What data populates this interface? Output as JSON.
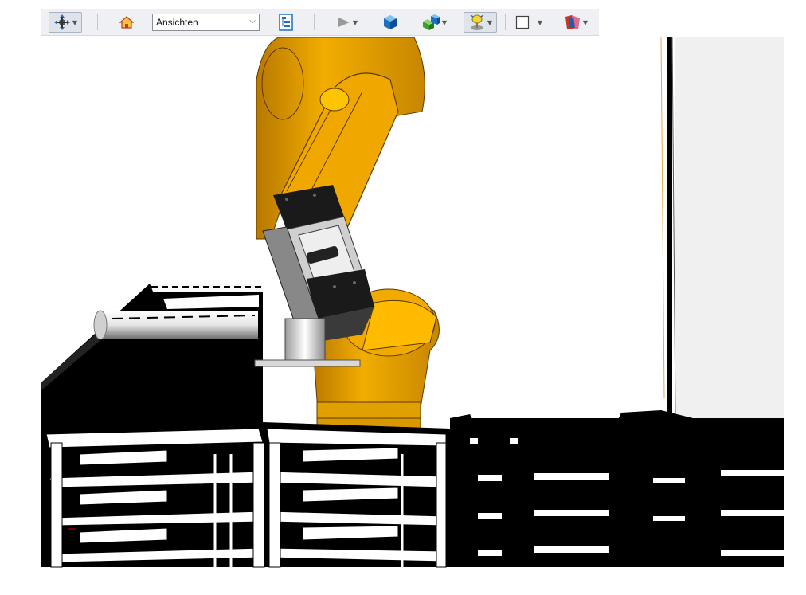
{
  "toolbar": {
    "items": [
      {
        "icon": "navigate-icon",
        "has_menu": true,
        "pressed": true
      },
      {
        "icon": "home-icon",
        "has_menu": false
      },
      {
        "icon": "tree-view-icon",
        "has_menu": false
      },
      {
        "icon": "play-icon",
        "has_menu": true
      },
      {
        "icon": "blue-cube-icon",
        "has_menu": false
      },
      {
        "icon": "display-style-icon",
        "has_menu": true
      },
      {
        "icon": "lighting-icon",
        "has_menu": true,
        "pressed": true
      },
      {
        "icon": "background-icon",
        "has_menu": true
      },
      {
        "icon": "section-icon",
        "has_menu": true
      }
    ],
    "view_select": {
      "value": "Ansichten"
    }
  },
  "colors": {
    "robot": "#e8a000",
    "robot_dark": "#8a5a00",
    "panel": "#f0f0f0",
    "black": "#000000",
    "toolbar_bg": "#eef0f3"
  }
}
